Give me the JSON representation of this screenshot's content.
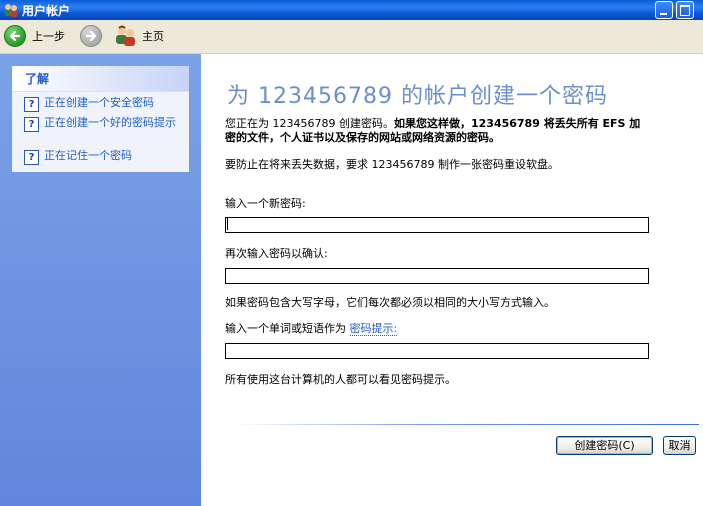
{
  "window": {
    "title": "用户帐户"
  },
  "toolbar": {
    "back_label": "上一步",
    "home_label": "主页"
  },
  "sidebar": {
    "header": "了解",
    "items": [
      {
        "label": "正在创建一个安全密码"
      },
      {
        "label": "正在创建一个好的密码提示"
      },
      {
        "label": "正在记住一个密码"
      }
    ]
  },
  "main": {
    "heading": "为 123456789 的帐户创建一个密码",
    "warning_prefix": "您正在为 123456789 创建密码。",
    "warning_bold": "如果您这样做，123456789 将丢失所有 EFS 加密的文件，个人证书以及保存的网站或网络资源的密码。",
    "reset_disk_note": "要防止在将来丢失数据，要求 123456789 制作一张密码重设软盘。",
    "new_password_label": "输入一个新密码:",
    "new_password_value": "",
    "confirm_password_label": "再次输入密码以确认:",
    "confirm_password_value": "",
    "case_note": "如果密码包含大写字母，它们每次都必须以相同的大小写方式输入。",
    "hint_label_prefix": "输入一个单词或短语作为",
    "hint_link": "密码提示:",
    "hint_value": "",
    "hint_note": "所有使用这台计算机的人都可以看见密码提示。",
    "create_button": "创建密码(C)",
    "cancel_button": "取消"
  }
}
